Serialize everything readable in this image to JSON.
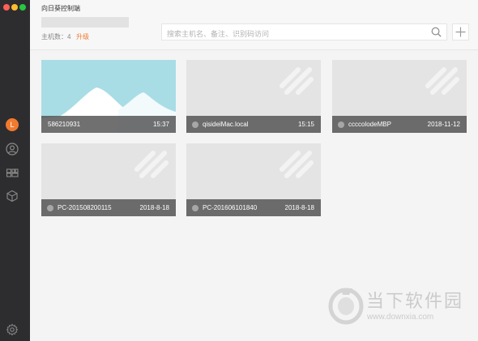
{
  "app": {
    "title": "向日葵控制端",
    "host_count_label": "主机数：4",
    "upgrade_label": "升级"
  },
  "search": {
    "placeholder": "搜索主机名、备注、识别码访问"
  },
  "sidebar": {
    "avatar_letter": "L",
    "icons": [
      "user-circle-icon",
      "apps-grid-icon",
      "cube-icon",
      "settings-icon"
    ]
  },
  "hosts": [
    {
      "name": "586210931",
      "time": "15:37",
      "thumbnail": "landscape",
      "status": "none"
    },
    {
      "name": "qisideiMac.local",
      "time": "15:15",
      "thumbnail": "placeholder",
      "status": "offline"
    },
    {
      "name": "ccccolodeMBP",
      "time": "2018-11-12",
      "thumbnail": "placeholder",
      "status": "offline"
    },
    {
      "name": "PC-201508200115",
      "time": "2018-8-18",
      "thumbnail": "placeholder",
      "status": "offline"
    },
    {
      "name": "PC-201606101840",
      "time": "2018-8-18",
      "thumbnail": "placeholder",
      "status": "offline"
    }
  ],
  "watermark": {
    "brand": "当下软件园",
    "url": "www.downxia.com"
  },
  "colors": {
    "accent": "#f07a2e",
    "sidebar": "#2d2d2f",
    "caption_bar": "#505050",
    "thumb_sky": "#a8dde5"
  }
}
